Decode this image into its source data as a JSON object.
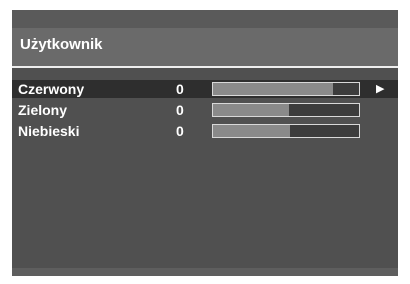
{
  "menu": {
    "title": "Użytkownik",
    "items": [
      {
        "label": "Czerwony",
        "value": "0",
        "level": 0.82,
        "selected": true,
        "arrow": "▶"
      },
      {
        "label": "Zielony",
        "value": "0",
        "level": 0.52,
        "selected": false
      },
      {
        "label": "Niebieski",
        "value": "0",
        "level": 0.53,
        "selected": false
      }
    ]
  },
  "colors": {
    "background": "#4a4a4a",
    "title_bar": "#6a6a6a",
    "selected_row": "#2e2e2e",
    "text": "#ffffff",
    "bar_fill": "#8a8a8a"
  }
}
